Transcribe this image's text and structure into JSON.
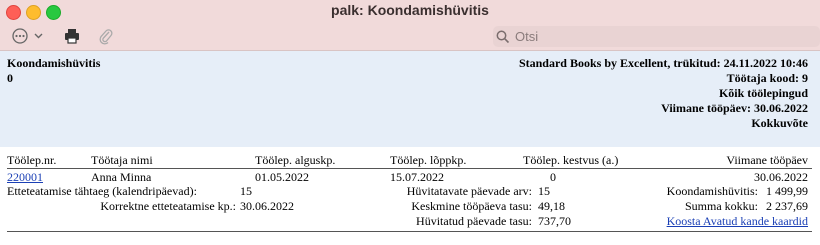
{
  "window": {
    "title": "palk: Koondamishüvitis"
  },
  "toolbar": {
    "search_placeholder": "Otsi"
  },
  "report": {
    "title": "Koondamishüvitis",
    "subtitle": "0",
    "meta": {
      "line1": "Standard Books by Excellent, trükitud: 24.11.2022 10:46",
      "line2": "Töötaja kood: 9",
      "line3": "Kõik töölepingud",
      "line4": "Viimane tööpäev: 30.06.2022",
      "line5": "Kokkuvõte"
    },
    "columns": [
      "Töölep.nr.",
      "Töötaja nimi",
      "Töölep. alguskp.",
      "Töölep. lõppkp.",
      "Töölep. kestvus (a.)",
      "Viimane tööpäev"
    ],
    "row": {
      "contract_no": "220001",
      "employee": "Anna Minna",
      "start": "01.05.2022",
      "end": "15.07.2022",
      "duration": "0",
      "last_day": "30.06.2022"
    },
    "details": {
      "notice_label": "Etteteatamise tähtaeg (kalendripäevad):",
      "notice_value": "15",
      "correct_label": "Korrektne etteteatamise kp.:",
      "correct_value": "30.06.2022",
      "comp_days_label": "Hüvitatavate päevade arv:",
      "comp_days_value": "15",
      "avg_pay_label": "Keskmine tööpäeva tasu:",
      "avg_pay_value": "49,18",
      "comp_pay_label": "Hüvitatud päevade tasu:",
      "comp_pay_value": "737,70",
      "severance_label": "Koondamishüvitis:",
      "severance_value": "1 499,99",
      "total_label": "Summa kokku:",
      "total_value": "2 237,69",
      "action_link": "Koosta Avatud kande kaardid"
    }
  }
}
